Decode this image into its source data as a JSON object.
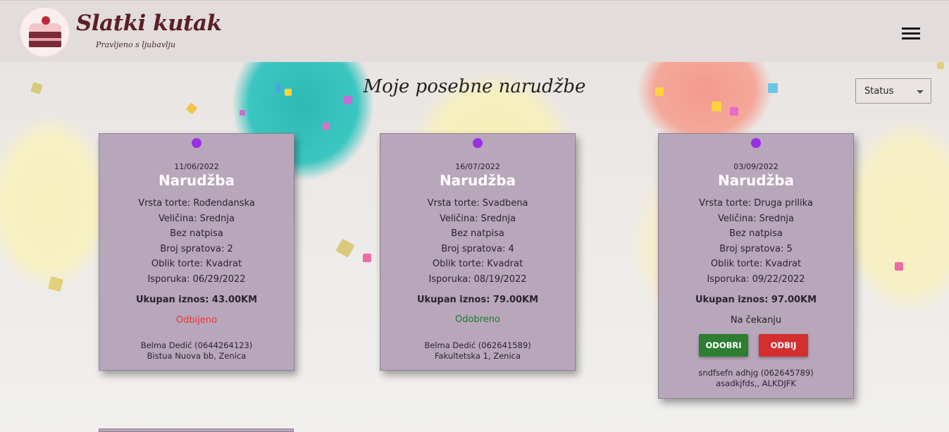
{
  "header": {
    "brand_title": "Slatki kutak",
    "brand_subtitle": "Pravljeno s ljubavlju",
    "menu_icon": "hamburger-menu-icon"
  },
  "page": {
    "title": "Moje posebne narudžbe",
    "status_filter": {
      "selected": "Status",
      "icon": "dropdown-arrow-icon"
    }
  },
  "orders": [
    {
      "date": "11/06/2022",
      "title": "Narudžba",
      "type": "Vrsta torte: Rođendanska",
      "size": "Veličina: Srednja",
      "inscription": "Bez natpisa",
      "tiers": "Broj spratova: 2",
      "shape": "Oblik torte: Kvadrat",
      "delivery": "Isporuka: 06/29/2022",
      "total": "Ukupan iznos: 43.00KM",
      "status": "Odbijeno",
      "status_color": "#e53935",
      "customer": "Belma Dedić (0644264123)",
      "address": "Bistua Nuova bb, Zenica"
    },
    {
      "date": "16/07/2022",
      "title": "Narudžba",
      "type": "Vrsta torte: Svadbena",
      "size": "Veličina: Srednja",
      "inscription": "Bez natpisa",
      "tiers": "Broj spratova: 4",
      "shape": "Oblik torte: Kvadrat",
      "delivery": "Isporuka: 08/19/2022",
      "total": "Ukupan iznos: 79.00KM",
      "status": "Odobreno",
      "status_color": "#1b7a2c",
      "customer": "Belma Dedić (062641589)",
      "address": "Fakultetska 1, Zenica"
    },
    {
      "date": "03/09/2022",
      "title": "Narudžba",
      "type": "Vrsta torte: Druga prilika",
      "size": "Veličina: Srednja",
      "inscription": "Bez natpisa",
      "tiers": "Broj spratova: 5",
      "shape": "Oblik torte: Kvadrat",
      "delivery": "Isporuka: 09/22/2022",
      "total": "Ukupan iznos: 97.00KM",
      "status": "Na čekanju",
      "status_color": "#222222",
      "approve_label": "ODOBRI",
      "reject_label": "ODBIJ",
      "customer": "sndfsefn adhjg (062645789)",
      "address": "asadkjfds,, ALKDJFK"
    }
  ],
  "colors": {
    "header_bg": "#e2dcdc",
    "card_bg": "#b8a6ba",
    "pin": "#9a30e6",
    "approve": "#2e7d32",
    "reject": "#d32f2f"
  }
}
